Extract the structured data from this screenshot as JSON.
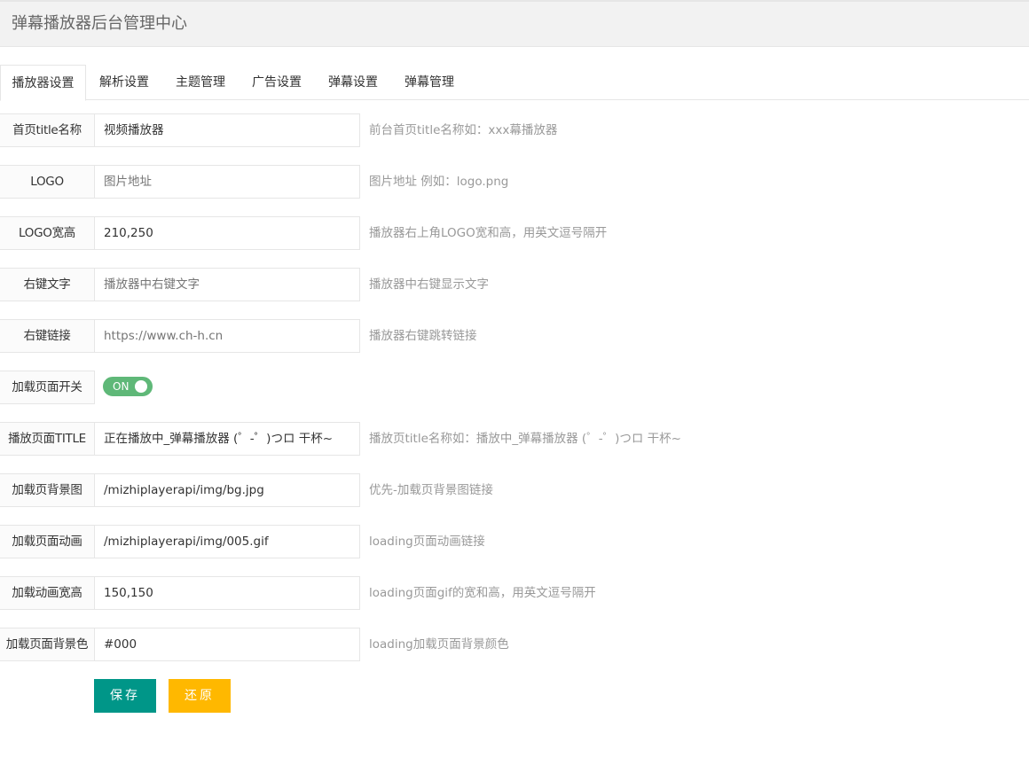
{
  "header": {
    "title": "弹幕播放器后台管理中心"
  },
  "tabs": [
    {
      "label": "播放器设置",
      "active": true
    },
    {
      "label": "解析设置",
      "active": false
    },
    {
      "label": "主题管理",
      "active": false
    },
    {
      "label": "广告设置",
      "active": false
    },
    {
      "label": "弹幕设置",
      "active": false
    },
    {
      "label": "弹幕管理",
      "active": false
    }
  ],
  "form": {
    "rows": [
      {
        "label": "首页title名称",
        "value": "视频播放器",
        "placeholder": "",
        "aux": "前台首页title名称如：xxx幕播放器"
      },
      {
        "label": "LOGO",
        "value": "",
        "placeholder": "图片地址",
        "aux": "图片地址 例如：logo.png"
      },
      {
        "label": "LOGO宽高",
        "value": "210,250",
        "placeholder": "",
        "aux": "播放器右上角LOGO宽和高，用英文逗号隔开"
      },
      {
        "label": "右键文字",
        "value": "",
        "placeholder": "播放器中右键文字",
        "aux": "播放器中右键显示文字"
      },
      {
        "label": "右键链接",
        "value": "",
        "placeholder": "https://www.ch-h.cn",
        "aux": "播放器右键跳转链接"
      },
      {
        "label": "加载页面开关",
        "toggle": {
          "state": "ON",
          "on": true
        }
      },
      {
        "label": "播放页面TITLE",
        "value": "正在播放中_弹幕播放器 (゜-゜)つロ 干杯~",
        "placeholder": "",
        "aux": "播放页title名称如：播放中_弹幕播放器 (゜-゜)つロ 干杯~"
      },
      {
        "label": "加载页背景图",
        "value": "/mizhiplayerapi/img/bg.jpg",
        "placeholder": "",
        "aux": "优先-加载页背景图链接"
      },
      {
        "label": "加载页面动画",
        "value": "/mizhiplayerapi/img/005.gif",
        "placeholder": "",
        "aux": "loading页面动画链接"
      },
      {
        "label": "加载动画宽高",
        "value": "150,150",
        "placeholder": "",
        "aux": "loading页面gif的宽和高，用英文逗号隔开"
      },
      {
        "label": "加载页面背景色",
        "value": "#000",
        "placeholder": "",
        "aux": "loading加载页面背景颜色"
      }
    ]
  },
  "buttons": {
    "save": "保存",
    "reset": "还原"
  },
  "colors": {
    "save": "#009688",
    "reset": "#ffb800",
    "toggle_on": "#5fb878"
  }
}
